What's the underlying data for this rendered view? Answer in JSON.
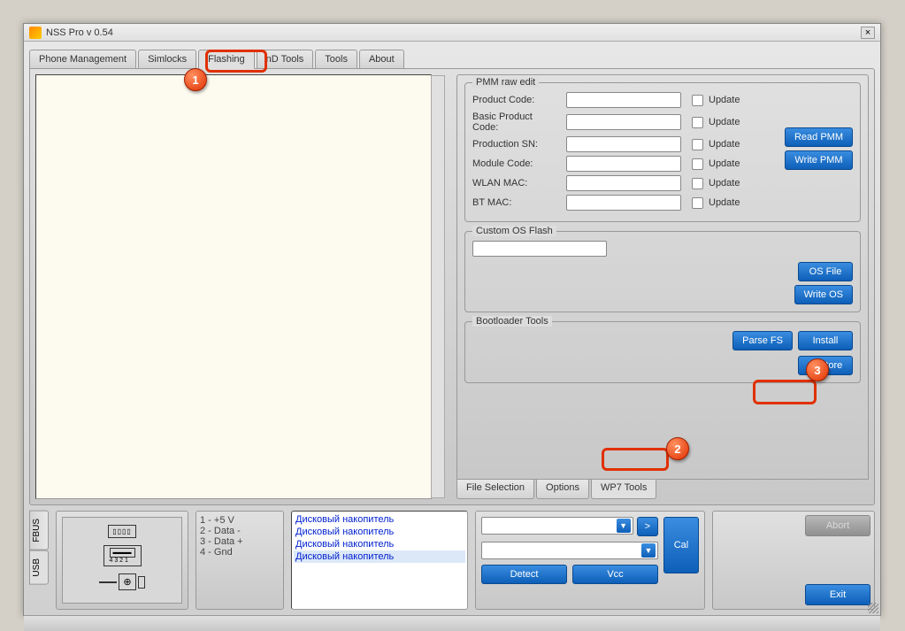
{
  "window": {
    "title": "NSS Pro v 0.54"
  },
  "tabs": [
    "Phone Management",
    "Simlocks",
    "Flashing",
    "nD Tools",
    "Tools",
    "About"
  ],
  "activeTab": 2,
  "rightTabs": [
    "File Selection",
    "Options",
    "WP7 Tools"
  ],
  "activeRightTab": 2,
  "pmm": {
    "title": "PMM raw edit",
    "rows": [
      {
        "label": "Product Code:",
        "check": "Update"
      },
      {
        "label": "Basic Product Code:",
        "check": "Update"
      },
      {
        "label": "Production SN:",
        "check": "Update"
      },
      {
        "label": "Module Code:",
        "check": "Update"
      },
      {
        "label": "WLAN MAC:",
        "check": "Update"
      },
      {
        "label": "BT MAC:",
        "check": "Update"
      }
    ],
    "readBtn": "Read PMM",
    "writeBtn": "Write PMM"
  },
  "osflash": {
    "title": "Custom OS Flash",
    "osFileBtn": "OS File",
    "writeOsBtn": "Write OS"
  },
  "bootloader": {
    "title": "Bootloader Tools",
    "parseBtn": "Parse FS",
    "installBtn": "Install",
    "restoreBtn": "Restore"
  },
  "sideTabs": [
    "FBUS",
    "USB"
  ],
  "legend": [
    "1 - +5 V",
    "2 - Data -",
    "3 - Data +",
    "4 - Gnd"
  ],
  "usbLabel": "4 3 2 1",
  "listItems": [
    "Дисковый накопитель",
    "Дисковый накопитель",
    "Дисковый накопитель",
    "Дисковый накопитель"
  ],
  "ctrl": {
    "arrow": ">",
    "detect": "Detect",
    "vcc": "Vcc",
    "cal": "Cal"
  },
  "exit": {
    "abort": "Abort",
    "exit": "Exit"
  },
  "callouts": {
    "c1": "1",
    "c2": "2",
    "c3": "3"
  }
}
